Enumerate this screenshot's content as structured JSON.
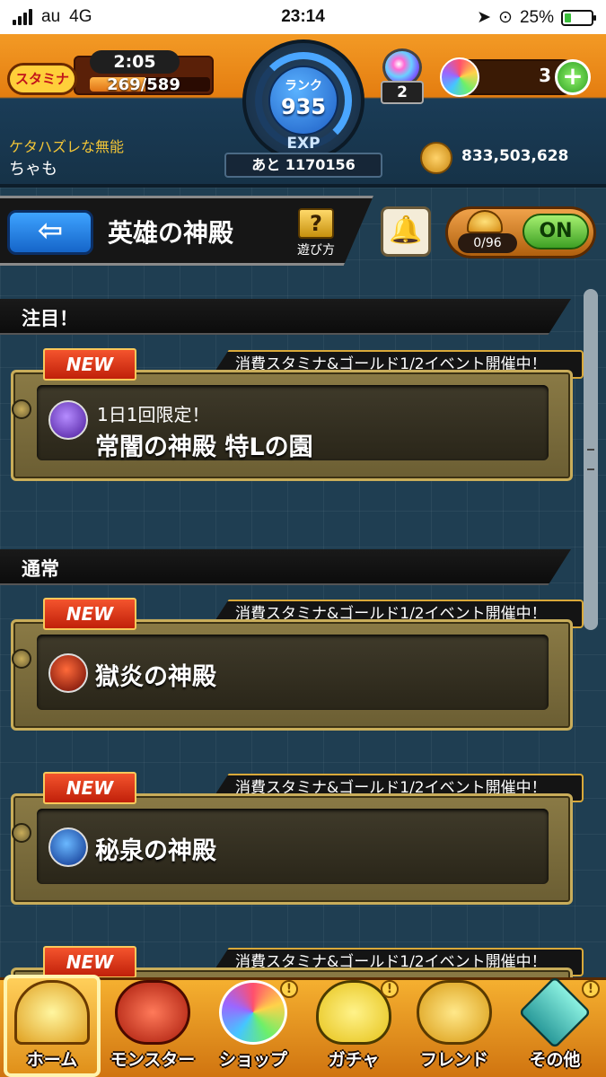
{
  "status_bar": {
    "carrier": "au",
    "network": "4G",
    "time": "23:14",
    "battery_percent": "25%",
    "battery_level": 0.25
  },
  "header": {
    "stamina_label": "スタミナ",
    "stamina_timer": "2:05",
    "stamina_count": "269/589",
    "stamina_fill": 0.46,
    "rank_label": "ランク",
    "rank_value": "935",
    "exp_label": "EXP",
    "exp_remaining": "あと 1170156",
    "flask_count": "2",
    "orb_count": "3",
    "orb_plus": "+",
    "user_title": "ケタハズレな無能",
    "user_name": "ちゃも",
    "gold": "833,503,628"
  },
  "nav": {
    "back_label": "⇦",
    "title": "英雄の神殿",
    "help_icon": "?",
    "help_label": "遊び方",
    "bell_icon": "🔔",
    "auto_count": "0/96",
    "auto_toggle": "ON"
  },
  "sections": {
    "featured": "注目！",
    "normal": "通常"
  },
  "quests": [
    {
      "badge": "NEW",
      "event": "消費スタミナ&ゴールド1/2イベント開催中！",
      "subtitle": "1日1回限定！",
      "name": "常闇の神殿 特Lの園",
      "element": "dark"
    },
    {
      "badge": "NEW",
      "event": "消費スタミナ&ゴールド1/2イベント開催中！",
      "name": "獄炎の神殿",
      "element": "fire"
    },
    {
      "badge": "NEW",
      "event": "消費スタミナ&ゴールド1/2イベント開催中！",
      "name": "秘泉の神殿",
      "element": "water"
    },
    {
      "badge": "NEW",
      "event": "消費スタミナ&ゴールド1/2イベント開催中！"
    }
  ],
  "tabs": [
    {
      "label": "ホーム"
    },
    {
      "label": "モンスター"
    },
    {
      "label": "ショップ",
      "alert": "!"
    },
    {
      "label": "ガチャ",
      "alert": "!"
    },
    {
      "label": "フレンド"
    },
    {
      "label": "その他",
      "alert": "!"
    }
  ],
  "colors": {
    "header_orange": "#f39a25",
    "grid_blue": "#1f3e52",
    "card_gold": "#c9ad5a",
    "new_red": "#e03a1a",
    "toggle_green": "#3ea024"
  }
}
